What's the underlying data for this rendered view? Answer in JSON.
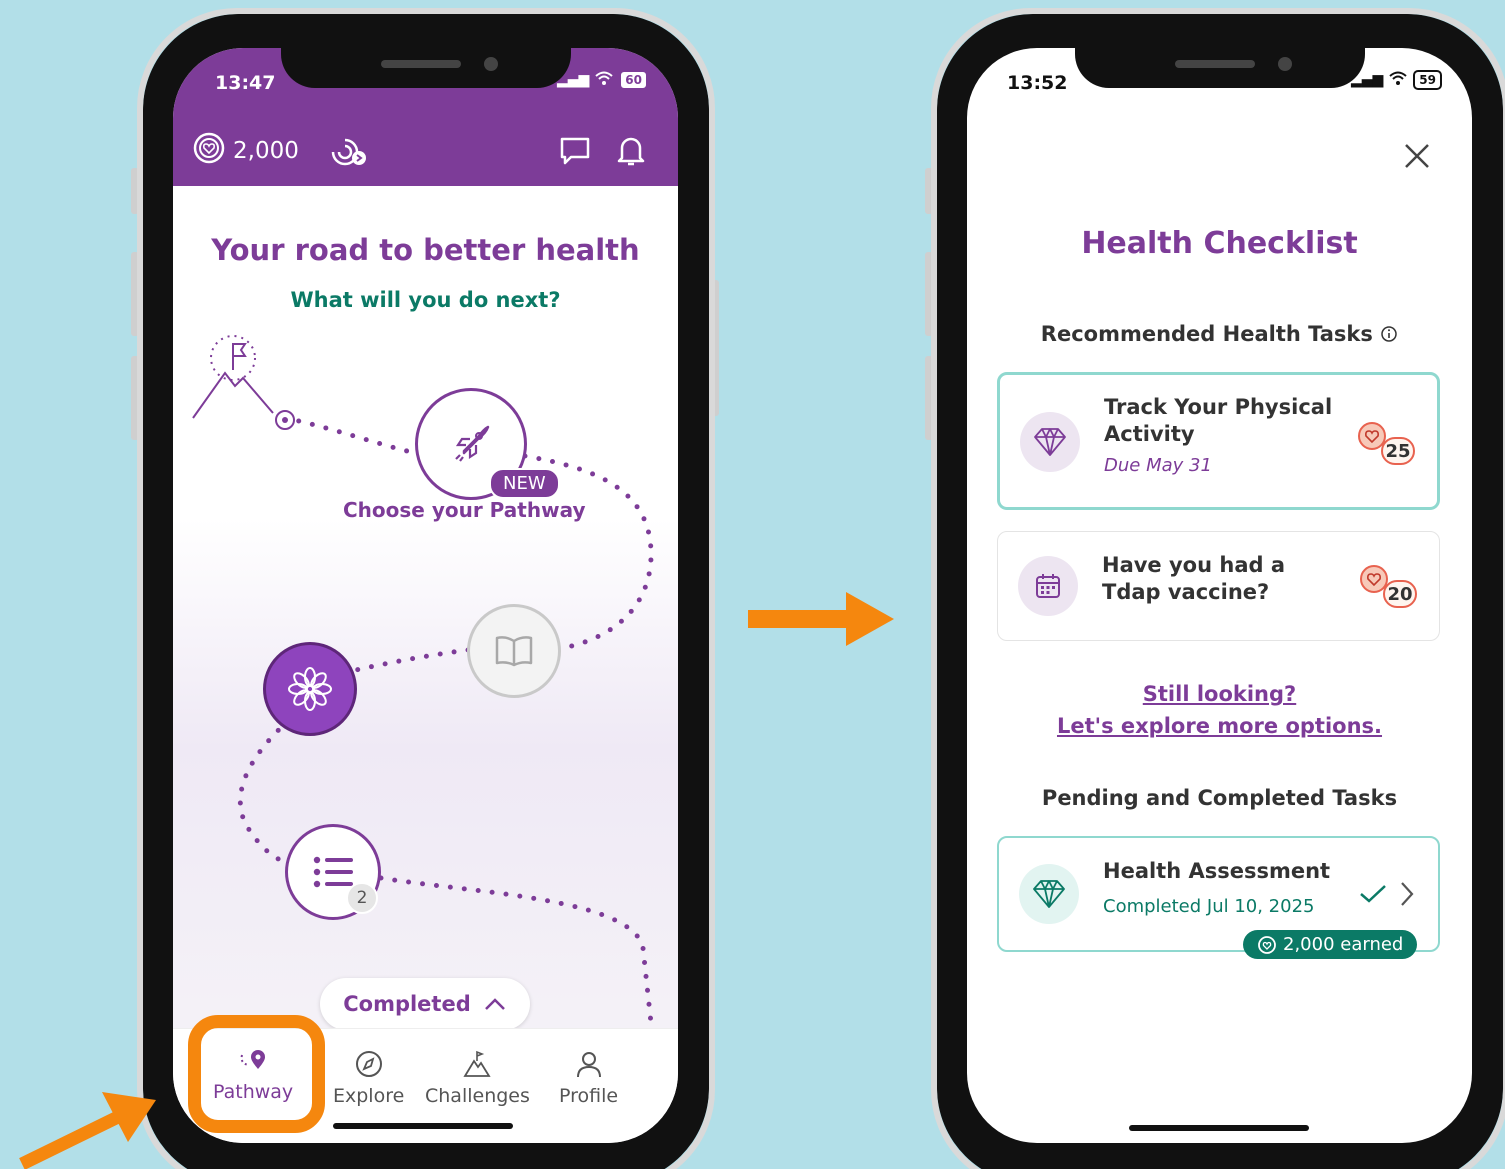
{
  "left_phone": {
    "status_time": "13:47",
    "battery": "60",
    "points": "2,000",
    "title": "Your road to better health",
    "subtitle": "What will you do next?",
    "new_badge": "NEW",
    "choose_pathway": "Choose your Pathway",
    "list_count": "2",
    "completed_pill": "Completed",
    "nav": [
      {
        "label": "Pathway",
        "icon": "pathway-icon",
        "active": true
      },
      {
        "label": "Explore",
        "icon": "compass-icon",
        "active": false
      },
      {
        "label": "Challenges",
        "icon": "mountain-icon",
        "active": false
      },
      {
        "label": "Profile",
        "icon": "person-icon",
        "active": false
      }
    ]
  },
  "right_phone": {
    "status_time": "13:52",
    "battery": "59",
    "title": "Health Checklist",
    "recommended_heading": "Recommended Health Tasks",
    "tasks": [
      {
        "title": "Track Your Physical Activity",
        "due": "Due May 31",
        "reward": "25",
        "icon": "diamond-icon"
      },
      {
        "title": "Have you had a Tdap vaccine?",
        "reward": "20",
        "icon": "calendar-icon"
      }
    ],
    "still_looking": "Still looking?",
    "explore_more": "Let's explore more options.",
    "pending_heading": "Pending and Completed Tasks",
    "completed_task": {
      "title": "Health Assessment",
      "date": "Completed Jul 10, 2025",
      "earned": "2,000 earned"
    }
  },
  "colors": {
    "brand_purple": "#7d3c98",
    "teal": "#0b7a66",
    "highlight_orange": "#f5870e",
    "background": "#b2dfe8"
  }
}
